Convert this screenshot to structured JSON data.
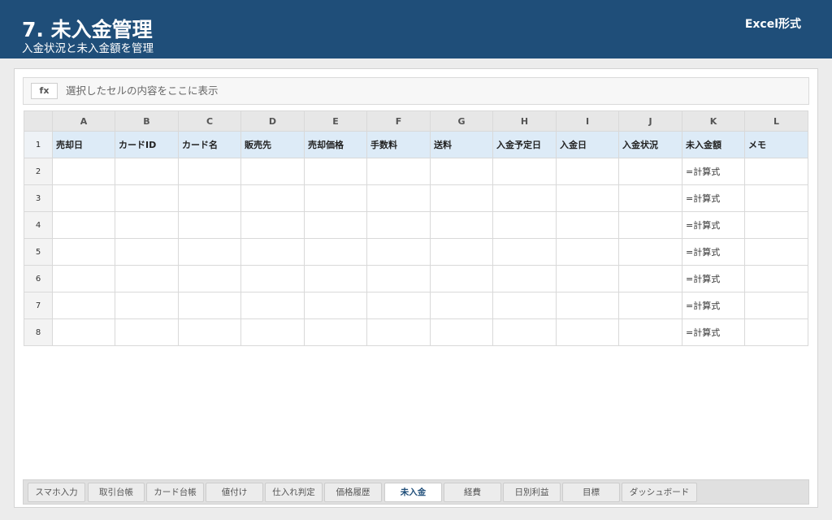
{
  "header": {
    "title": "7. 未入金管理",
    "subtitle": "入金状況と未入金額を管理",
    "format_label": "Excel形式"
  },
  "formula_bar": {
    "fx_label": "fx",
    "placeholder_text": "選択したセルの内容をここに表示"
  },
  "grid": {
    "column_letters": [
      "A",
      "B",
      "C",
      "D",
      "E",
      "F",
      "G",
      "H",
      "I",
      "J",
      "K",
      "L"
    ],
    "header_row_number": "1",
    "headers": [
      "売却日",
      "カードID",
      "カード名",
      "販売先",
      "売却価格",
      "手数料",
      "送料",
      "入金予定日",
      "入金日",
      "入金状況",
      "未入金額",
      "メモ"
    ],
    "rows": [
      {
        "num": "2",
        "cells": [
          "",
          "",
          "",
          "",
          "",
          "",
          "",
          "",
          "",
          "",
          "=計算式",
          ""
        ]
      },
      {
        "num": "3",
        "cells": [
          "",
          "",
          "",
          "",
          "",
          "",
          "",
          "",
          "",
          "",
          "=計算式",
          ""
        ]
      },
      {
        "num": "4",
        "cells": [
          "",
          "",
          "",
          "",
          "",
          "",
          "",
          "",
          "",
          "",
          "=計算式",
          ""
        ]
      },
      {
        "num": "5",
        "cells": [
          "",
          "",
          "",
          "",
          "",
          "",
          "",
          "",
          "",
          "",
          "=計算式",
          ""
        ]
      },
      {
        "num": "6",
        "cells": [
          "",
          "",
          "",
          "",
          "",
          "",
          "",
          "",
          "",
          "",
          "=計算式",
          ""
        ]
      },
      {
        "num": "7",
        "cells": [
          "",
          "",
          "",
          "",
          "",
          "",
          "",
          "",
          "",
          "",
          "=計算式",
          ""
        ]
      },
      {
        "num": "8",
        "cells": [
          "",
          "",
          "",
          "",
          "",
          "",
          "",
          "",
          "",
          "",
          "=計算式",
          ""
        ]
      }
    ]
  },
  "sheet_tabs": [
    "スマホ入力",
    "取引台帳",
    "カード台帳",
    "値付け",
    "仕入れ判定",
    "価格履歴",
    "未入金",
    "経費",
    "日別利益",
    "目標",
    "ダッシュボード"
  ],
  "active_tab": "未入金",
  "colors": {
    "header_bg": "#1f4e79",
    "table_header_bg": "#ddebf7",
    "active_tab_text": "#1f4e79"
  }
}
